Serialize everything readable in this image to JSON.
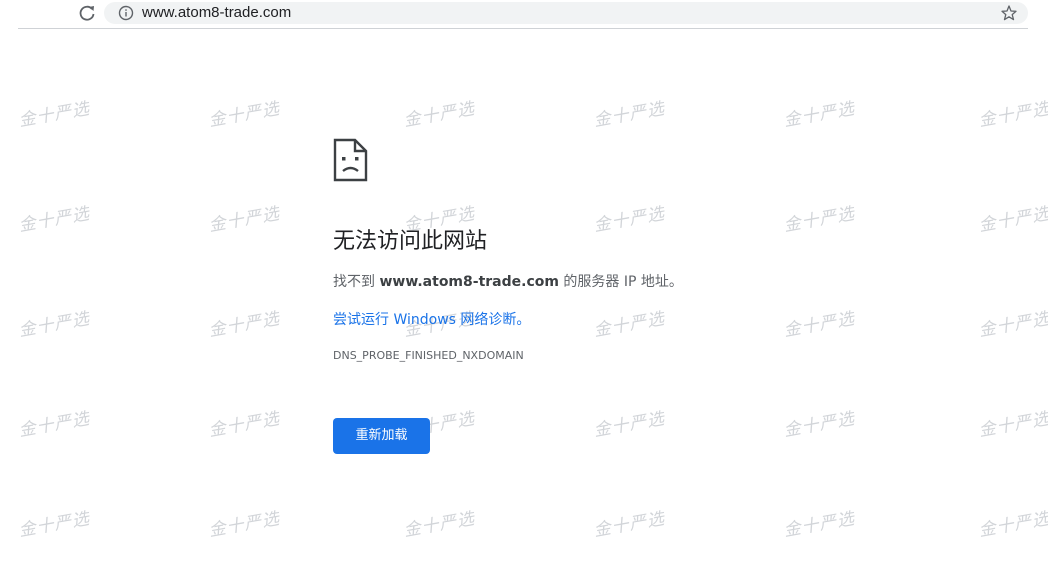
{
  "address_bar": {
    "url": "www.atom8-trade.com"
  },
  "icons": {
    "reload": "reload-icon",
    "site_info": "info-icon",
    "bookmark": "star-icon",
    "page": "sad-page-icon"
  },
  "error": {
    "title": "无法访问此网站",
    "desc_prefix": "找不到 ",
    "desc_host": "www.atom8-trade.com",
    "desc_suffix": " 的服务器 IP 地址。",
    "diagnose_link": "尝试运行 Windows 网络诊断。",
    "error_code": "DNS_PROBE_FINISHED_NXDOMAIN",
    "reload_button": "重新加载"
  },
  "watermark": {
    "text": "金十严选"
  },
  "colors": {
    "accent": "#1a73e8",
    "text_primary": "#202124",
    "text_secondary": "#5f6368",
    "watermark": "#d2d5d9"
  }
}
